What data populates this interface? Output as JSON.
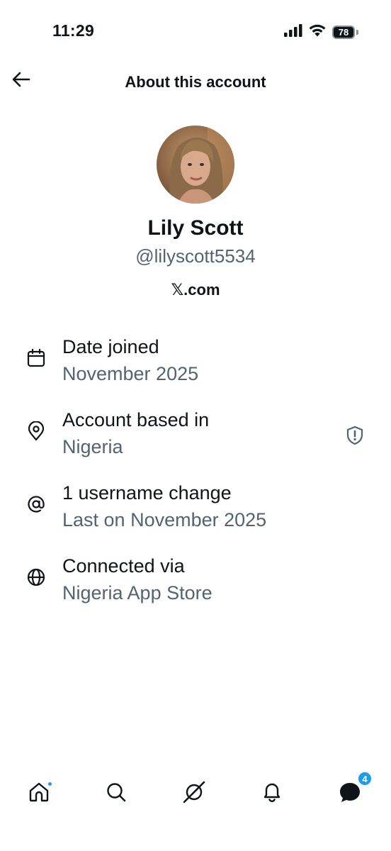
{
  "status_bar": {
    "time": "11:29",
    "battery": "78",
    "icons": [
      "signal-icon",
      "wifi-icon",
      "battery-icon"
    ]
  },
  "header": {
    "title": "About this account",
    "back_icon": "arrow-left-icon"
  },
  "profile": {
    "name": "Lily Scott",
    "handle": "@lilyscott5534",
    "platform": "𝕏.com"
  },
  "info": [
    {
      "icon": "calendar-icon",
      "title": "Date joined",
      "subtitle": "November 2025"
    },
    {
      "icon": "location-pin-icon",
      "title": "Account based in",
      "subtitle": "Nigeria",
      "action_icon": "shield-alert-icon"
    },
    {
      "icon": "at-sign-icon",
      "title": "1 username change",
      "subtitle": "Last on November 2025"
    },
    {
      "icon": "globe-icon",
      "title": "Connected via",
      "subtitle": "Nigeria App Store"
    }
  ],
  "bottom_nav": {
    "items": [
      "home-icon",
      "search-icon",
      "grok-icon",
      "notifications-icon",
      "messages-icon"
    ],
    "messages_badge": "4"
  },
  "colors": {
    "text_primary": "#0f1419",
    "text_secondary": "#536471",
    "accent": "#1d9bf0"
  }
}
